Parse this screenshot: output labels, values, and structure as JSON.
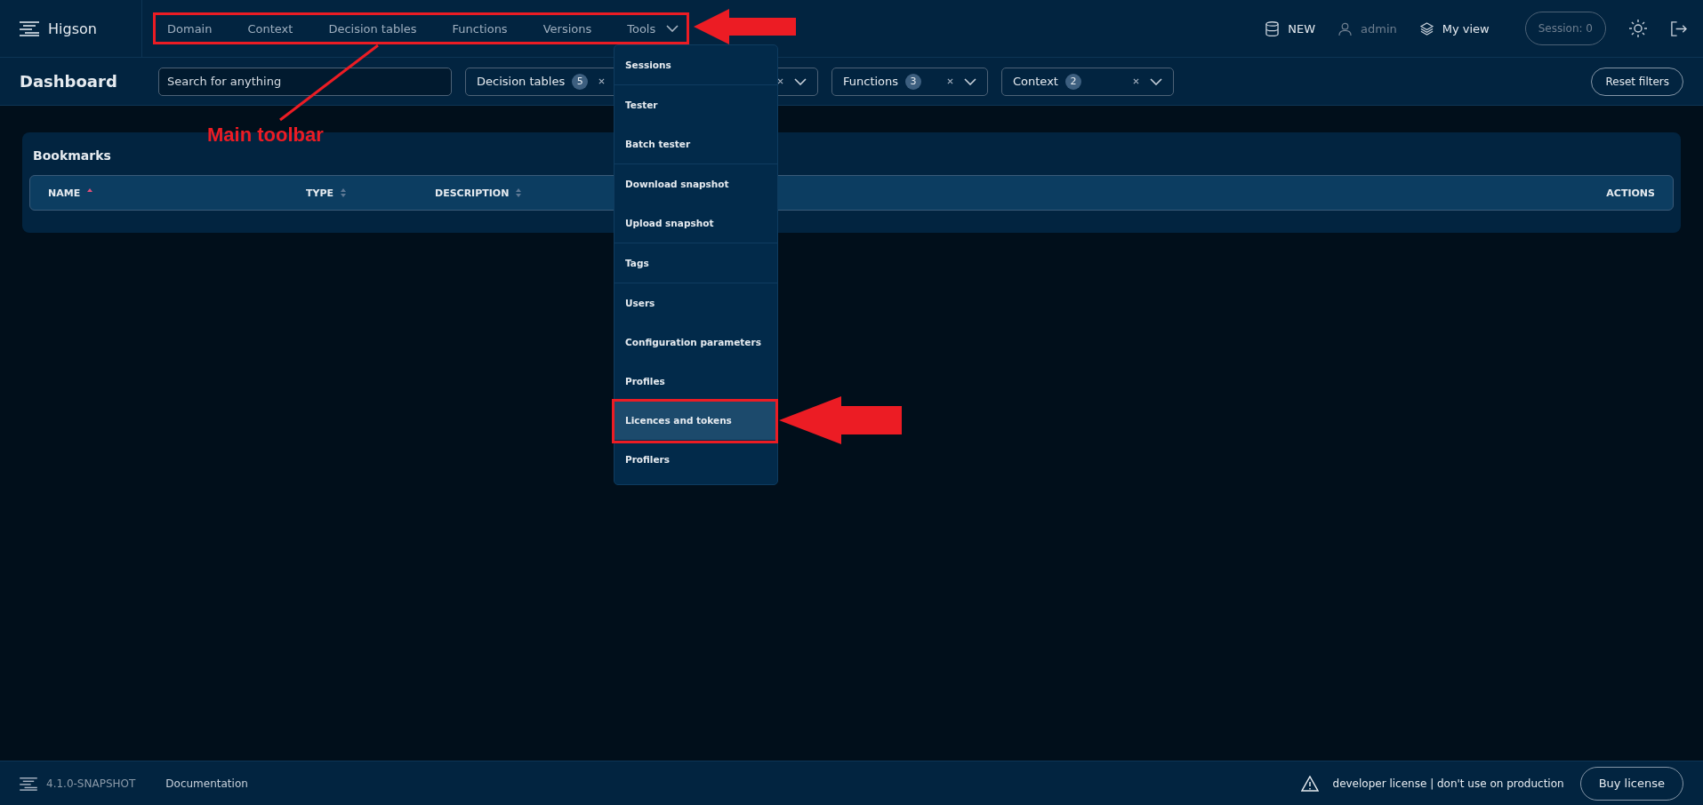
{
  "app": {
    "name": "Higson"
  },
  "nav": [
    {
      "label": "Domain",
      "kind": "link"
    },
    {
      "label": "Context",
      "kind": "link"
    },
    {
      "label": "Decision tables",
      "kind": "link"
    },
    {
      "label": "Functions",
      "kind": "link"
    },
    {
      "label": "Versions",
      "kind": "link"
    },
    {
      "label": "Tools",
      "kind": "menu"
    }
  ],
  "header_right": {
    "version_tag": "NEW",
    "user": "admin",
    "view": "My view",
    "session": "Session: 0"
  },
  "page_title": "Dashboard",
  "search": {
    "placeholder": "Search for anything"
  },
  "filters": [
    {
      "kind": "labeled",
      "label": "Decision tables",
      "count": "5"
    },
    {
      "kind": "covered"
    },
    {
      "kind": "labeled",
      "label": "Functions",
      "count": "3"
    },
    {
      "kind": "labeled",
      "label": "Context",
      "count": "2"
    }
  ],
  "reset_button": "Reset filters",
  "tools_menu": {
    "expanded": true,
    "groups": [
      [
        {
          "label": "Sessions",
          "selected": false
        }
      ],
      [
        {
          "label": "Tester",
          "selected": false
        },
        {
          "label": "Batch tester",
          "selected": false
        }
      ],
      [
        {
          "label": "Download snapshot",
          "selected": false
        },
        {
          "label": "Upload snapshot",
          "selected": false
        }
      ],
      [
        {
          "label": "Tags",
          "selected": false
        }
      ],
      [
        {
          "label": "Users",
          "selected": false
        },
        {
          "label": "Configuration parameters",
          "selected": false
        },
        {
          "label": "Profiles",
          "selected": false
        },
        {
          "label": "Licences and tokens",
          "selected": true
        },
        {
          "label": "Profilers",
          "selected": false
        }
      ]
    ]
  },
  "bookmarks": {
    "title": "Bookmarks",
    "columns": [
      {
        "label": "NAME",
        "kind": "sortable",
        "sorted": true
      },
      {
        "label": "TYPE",
        "kind": "sortable",
        "sorted": false
      },
      {
        "label": "DESCRIPTION",
        "kind": "sortable",
        "sorted": false
      },
      {
        "label": "ACTIONS",
        "kind": "plain"
      }
    ]
  },
  "footer": {
    "version": "4.1.0-SNAPSHOT",
    "docs_link": "Documentation",
    "license_notice": "developer license | don't use on production",
    "buy_button": "Buy license"
  },
  "annotations": {
    "label": "Main toolbar"
  }
}
